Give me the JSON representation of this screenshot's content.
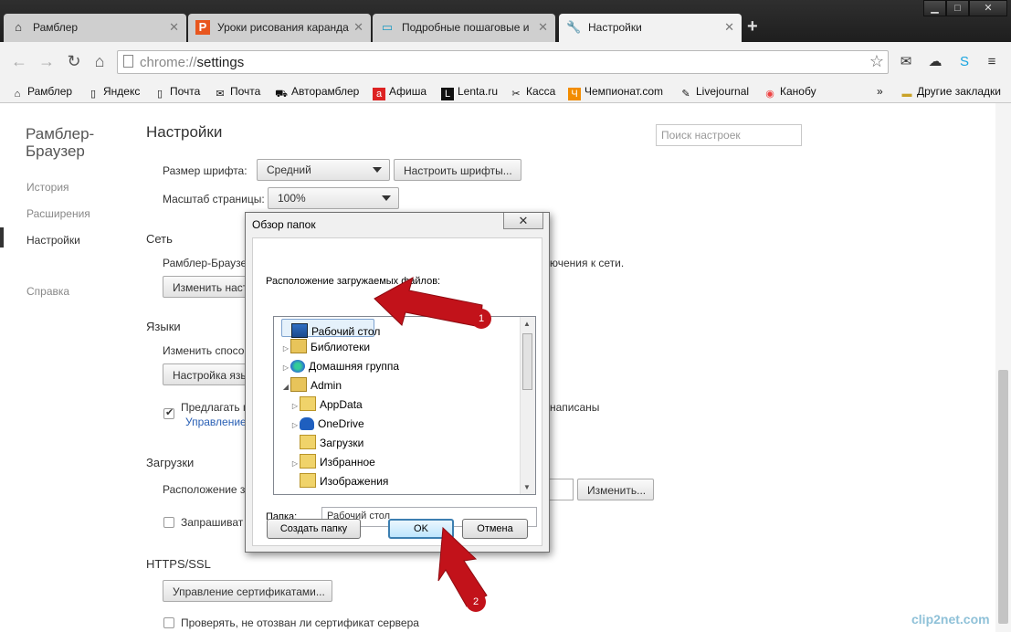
{
  "tabs": [
    {
      "label": "Рамблер",
      "icon": "house-icon"
    },
    {
      "label": "Уроки рисования каранда",
      "icon": "p-icon"
    },
    {
      "label": "Подробные пошаговые и",
      "icon": "monitor-icon"
    },
    {
      "label": "Настройки",
      "icon": "wrench-icon"
    }
  ],
  "omnibox": {
    "scheme": "chrome://",
    "path": "settings"
  },
  "bookmarks": [
    "Рамблер",
    "Яндекс",
    "Почта",
    "Почта",
    "Авторамблер",
    "Афиша",
    "Lenta.ru",
    "Касса",
    "Чемпионат.com",
    "Livejournal",
    "Канобу"
  ],
  "bookmarks_more": "»",
  "other_bookmarks": "Другие закладки",
  "sidebar": {
    "title": "Рамблер-Браузер",
    "items": [
      "История",
      "Расширения",
      "Настройки",
      "Справка"
    ]
  },
  "settings": {
    "title": "Настройки",
    "search_placeholder": "Поиск настроек",
    "font_size_label": "Размер шрифта:",
    "font_size_value": "Средний",
    "font_btn": "Настроить шрифты...",
    "zoom_label": "Масштаб страницы:",
    "zoom_value": "100%",
    "network_title": "Сеть",
    "network_text_left": "Рамблер-Браузе",
    "network_text_right": "ючения к сети.",
    "network_btn": "Изменить наст",
    "languages_title": "Языки",
    "languages_text": "Изменить спосо",
    "languages_btn": "Настройка язы",
    "offer_text": "Предлагать п",
    "offer_text_right": "написаны",
    "manage_link": "Управление",
    "downloads_title": "Загрузки",
    "downloads_location": "Расположение з",
    "change_btn": "Изменить...",
    "ask_text": "Запрашиват",
    "https_title": "HTTPS/SSL",
    "certs_btn": "Управление сертификатами...",
    "revocation_text": "Проверять, не отозван ли сертификат сервера"
  },
  "dialog": {
    "title": "Обзор папок",
    "close": "✕",
    "prompt": "Расположение загружаемых файлов:",
    "tree": [
      {
        "label": "Рабочий стол",
        "level": 0,
        "expander": "",
        "icon": "desktop-icon",
        "selected": true
      },
      {
        "label": "Библиотеки",
        "level": 0,
        "expander": "▷",
        "icon": "library-icon"
      },
      {
        "label": "Домашняя группа",
        "level": 0,
        "expander": "▷",
        "icon": "homegroup-icon"
      },
      {
        "label": "Admin",
        "level": 0,
        "expander": "◢",
        "icon": "user-folder-icon"
      },
      {
        "label": "AppData",
        "level": 1,
        "expander": "▷",
        "icon": "folder-icon"
      },
      {
        "label": "OneDrive",
        "level": 1,
        "expander": "▷",
        "icon": "onedrive-icon"
      },
      {
        "label": "Загрузки",
        "level": 1,
        "expander": "",
        "icon": "downloads-folder-icon"
      },
      {
        "label": "Избранное",
        "level": 1,
        "expander": "▷",
        "icon": "favorites-folder-icon"
      },
      {
        "label": "Изображения",
        "level": 1,
        "expander": "",
        "icon": "pictures-folder-icon"
      }
    ],
    "folder_label": "Папка:",
    "folder_value": "Рабочий стол",
    "new_folder_btn": "Создать папку",
    "ok_btn": "OK",
    "cancel_btn": "Отмена"
  },
  "annotations": [
    "1",
    "2"
  ],
  "watermark": "clip2net.com",
  "colors": {
    "annotation_red": "#c2121a",
    "link": "#2a60b5",
    "dialog_default_border": "#3c7fb1"
  }
}
